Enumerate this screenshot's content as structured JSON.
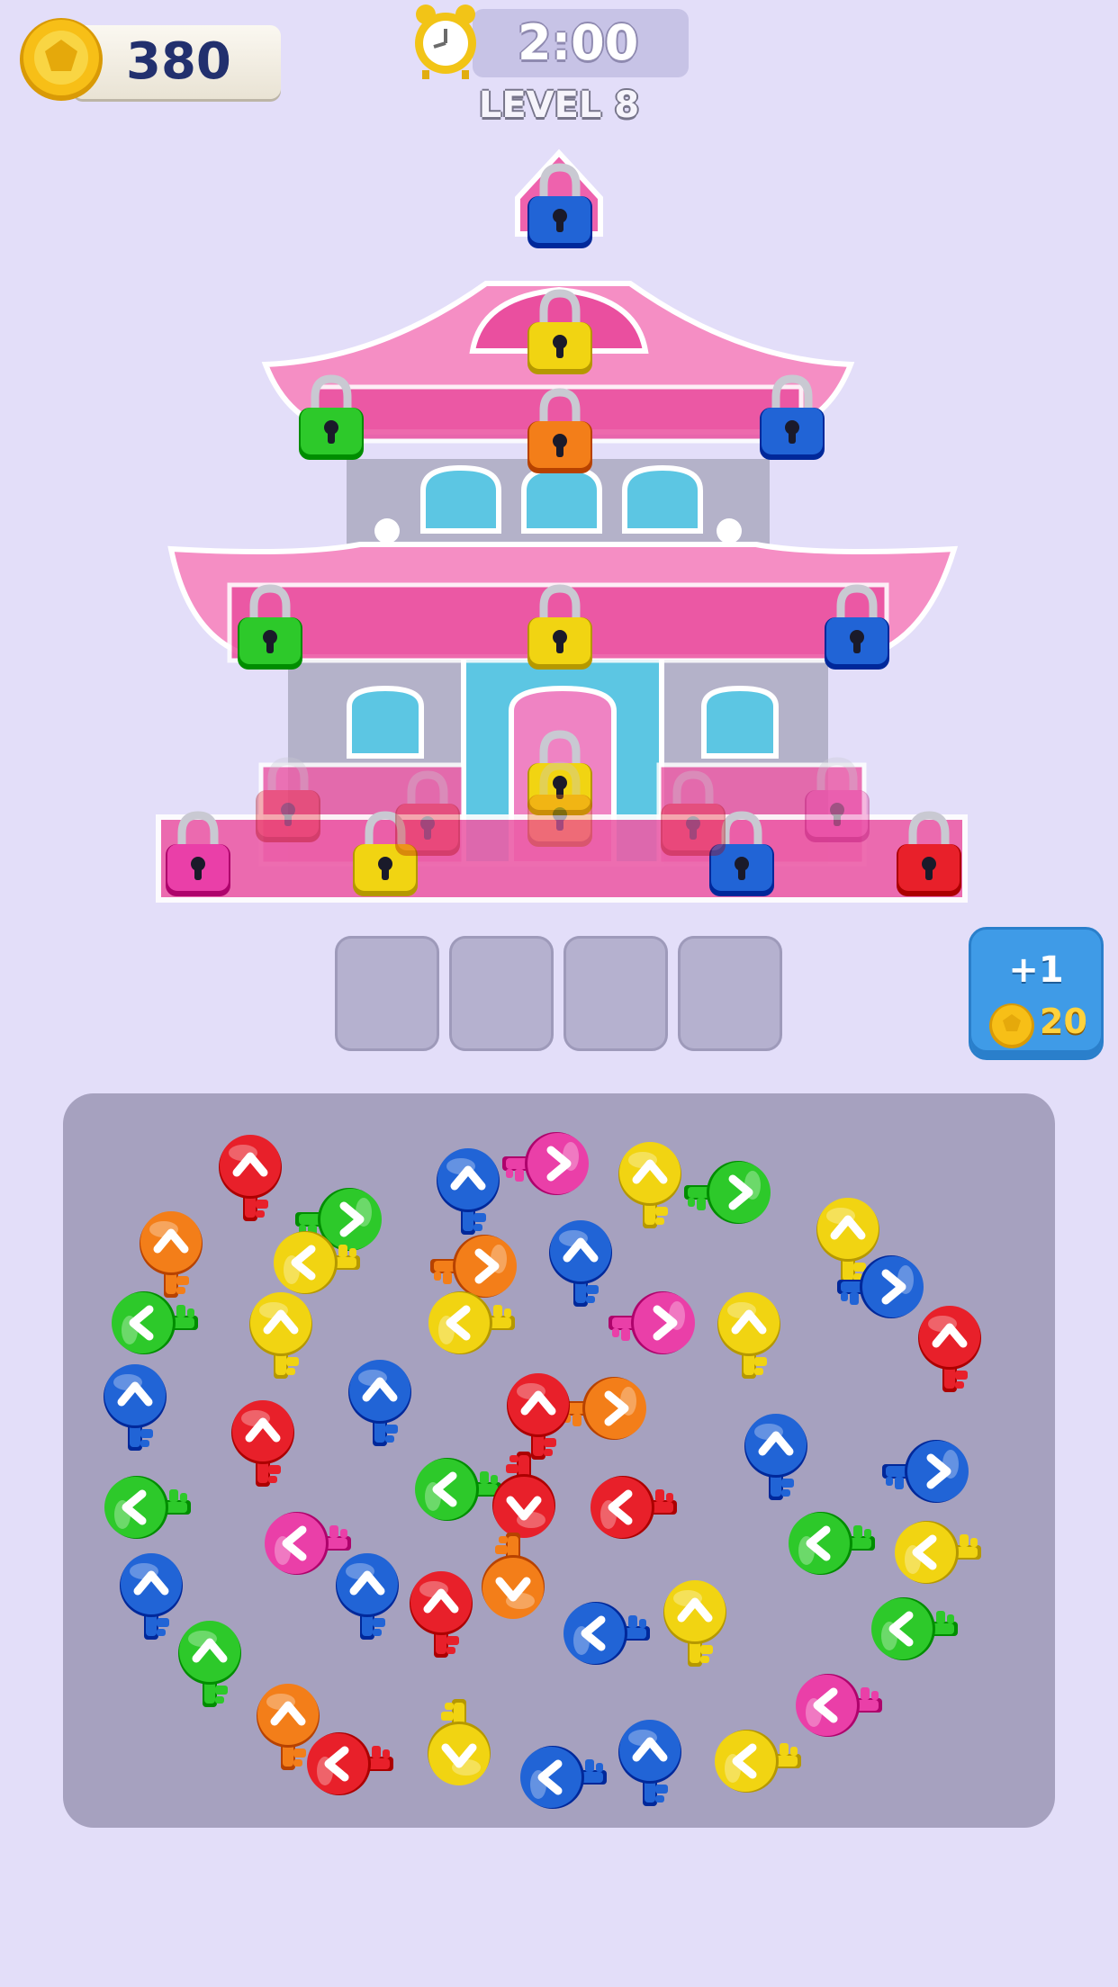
{
  "hud": {
    "coins": "380",
    "timer": "2:00",
    "level": "LEVEL 8"
  },
  "booster": {
    "label": "+1",
    "cost": "20"
  },
  "slots": [
    {
      "filled": false
    },
    {
      "filled": false
    },
    {
      "filled": false
    },
    {
      "filled": false
    }
  ],
  "colors": {
    "background": "#e3def9",
    "panel": "#a6a1bf",
    "red": "#e8202a",
    "orange": "#f37e19",
    "yellow": "#f1d412",
    "green": "#2dc92a",
    "blue": "#2164d6",
    "pink": "#ea3fa8"
  },
  "locks": [
    {
      "color": "blue",
      "state": "open"
    },
    {
      "color": "yellow",
      "state": "open"
    },
    {
      "color": "green",
      "state": "open"
    },
    {
      "color": "orange",
      "state": "open"
    },
    {
      "color": "blue",
      "state": "open"
    },
    {
      "color": "green",
      "state": "open"
    },
    {
      "color": "yellow",
      "state": "open"
    },
    {
      "color": "blue",
      "state": "open"
    },
    {
      "color": "yellow",
      "state": "open"
    },
    {
      "color": "pink",
      "state": "open"
    },
    {
      "color": "yellow",
      "state": "open"
    },
    {
      "color": "blue",
      "state": "open"
    },
    {
      "color": "red",
      "state": "open"
    },
    {
      "color": "red",
      "state": "faded"
    },
    {
      "color": "red",
      "state": "faded"
    },
    {
      "color": "orange",
      "state": "faded"
    },
    {
      "color": "red",
      "state": "faded"
    },
    {
      "color": "pink",
      "state": "faded"
    }
  ],
  "keys": [
    {
      "color": "red",
      "dir": "up"
    },
    {
      "color": "blue",
      "dir": "up"
    },
    {
      "color": "pink",
      "dir": "right"
    },
    {
      "color": "yellow",
      "dir": "up"
    },
    {
      "color": "green",
      "dir": "right"
    },
    {
      "color": "orange",
      "dir": "up"
    },
    {
      "color": "green",
      "dir": "right"
    },
    {
      "color": "yellow",
      "dir": "up"
    },
    {
      "color": "yellow",
      "dir": "left"
    },
    {
      "color": "orange",
      "dir": "right"
    },
    {
      "color": "blue",
      "dir": "up"
    },
    {
      "color": "blue",
      "dir": "right"
    },
    {
      "color": "green",
      "dir": "left"
    },
    {
      "color": "yellow",
      "dir": "up"
    },
    {
      "color": "yellow",
      "dir": "left"
    },
    {
      "color": "pink",
      "dir": "right"
    },
    {
      "color": "yellow",
      "dir": "up"
    },
    {
      "color": "red",
      "dir": "up"
    },
    {
      "color": "blue",
      "dir": "up"
    },
    {
      "color": "blue",
      "dir": "up"
    },
    {
      "color": "red",
      "dir": "up"
    },
    {
      "color": "orange",
      "dir": "right"
    },
    {
      "color": "red",
      "dir": "up"
    },
    {
      "color": "blue",
      "dir": "up"
    },
    {
      "color": "blue",
      "dir": "right"
    },
    {
      "color": "green",
      "dir": "left"
    },
    {
      "color": "green",
      "dir": "left"
    },
    {
      "color": "red",
      "dir": "down"
    },
    {
      "color": "red",
      "dir": "left"
    },
    {
      "color": "pink",
      "dir": "left"
    },
    {
      "color": "green",
      "dir": "left"
    },
    {
      "color": "yellow",
      "dir": "left"
    },
    {
      "color": "blue",
      "dir": "up"
    },
    {
      "color": "blue",
      "dir": "up"
    },
    {
      "color": "red",
      "dir": "up"
    },
    {
      "color": "orange",
      "dir": "down"
    },
    {
      "color": "blue",
      "dir": "left"
    },
    {
      "color": "yellow",
      "dir": "up"
    },
    {
      "color": "green",
      "dir": "left"
    },
    {
      "color": "green",
      "dir": "up"
    },
    {
      "color": "orange",
      "dir": "up"
    },
    {
      "color": "pink",
      "dir": "left"
    },
    {
      "color": "red",
      "dir": "left"
    },
    {
      "color": "yellow",
      "dir": "down"
    },
    {
      "color": "blue",
      "dir": "left"
    },
    {
      "color": "blue",
      "dir": "up"
    },
    {
      "color": "yellow",
      "dir": "left"
    }
  ]
}
